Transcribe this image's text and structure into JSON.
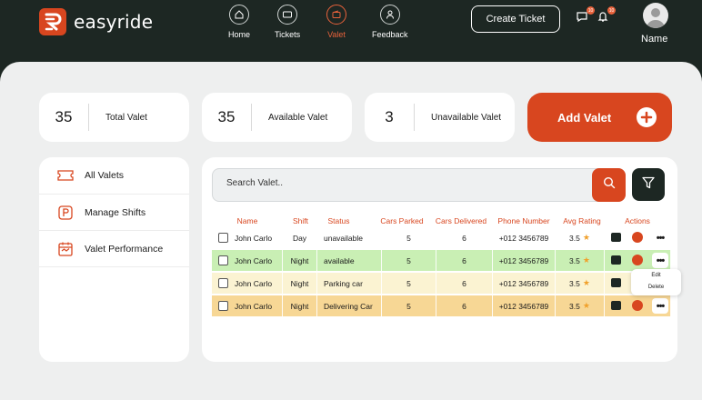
{
  "brand": {
    "name": "easyride"
  },
  "nav": [
    {
      "label": "Home",
      "icon": "home-icon"
    },
    {
      "label": "Tickets",
      "icon": "ticket-icon"
    },
    {
      "label": "Valet",
      "icon": "wallet-icon",
      "active": true
    },
    {
      "label": "Feedback",
      "icon": "user-icon"
    }
  ],
  "header": {
    "create_ticket": "Create Ticket",
    "chat_badge": "10",
    "bell_badge": "10",
    "user_name": "Name"
  },
  "stats": [
    {
      "value": "35",
      "label": "Total Valet"
    },
    {
      "value": "35",
      "label": "Available Valet"
    },
    {
      "value": "3",
      "label": "Unavailable Valet"
    }
  ],
  "add_valet": "Add Valet",
  "sidebar": [
    {
      "label": "All Valets",
      "icon": "ticket-icon"
    },
    {
      "label": "Manage Shifts",
      "icon": "parking-icon"
    },
    {
      "label": "Valet Performance",
      "icon": "calendar-icon"
    }
  ],
  "search": {
    "placeholder": "Search Valet.."
  },
  "table": {
    "columns": [
      "Name",
      "Shift",
      "Status",
      "Cars Parked",
      "Cars Delivered",
      "Phone Number",
      "Avg Rating",
      "Actions"
    ],
    "rows": [
      {
        "name": "John Carlo",
        "shift": "Day",
        "status": "unavailable",
        "parked": "5",
        "delivered": "6",
        "phone": "+012 3456789",
        "rating": "3.5",
        "bg": "#ffffff"
      },
      {
        "name": "John Carlo",
        "shift": "Night",
        "status": "available",
        "parked": "5",
        "delivered": "6",
        "phone": "+012 3456789",
        "rating": "3.5",
        "bg": "#c9efb4"
      },
      {
        "name": "John Carlo",
        "shift": "Night",
        "status": "Parking car",
        "parked": "5",
        "delivered": "6",
        "phone": "+012 3456789",
        "rating": "3.5",
        "bg": "#fbf3d2"
      },
      {
        "name": "John Carlo",
        "shift": "Night",
        "status": "Delivering Car",
        "parked": "5",
        "delivered": "6",
        "phone": "+012 3456789",
        "rating": "3.5",
        "bg": "#f7d795"
      }
    ]
  },
  "row_menu": {
    "edit": "Edit",
    "delete": "Delete"
  },
  "colors": {
    "accent": "#d8461f",
    "dark": "#1d2723",
    "available": "#c9efb4",
    "parking": "#fbf3d2",
    "delivering": "#f7d795"
  }
}
